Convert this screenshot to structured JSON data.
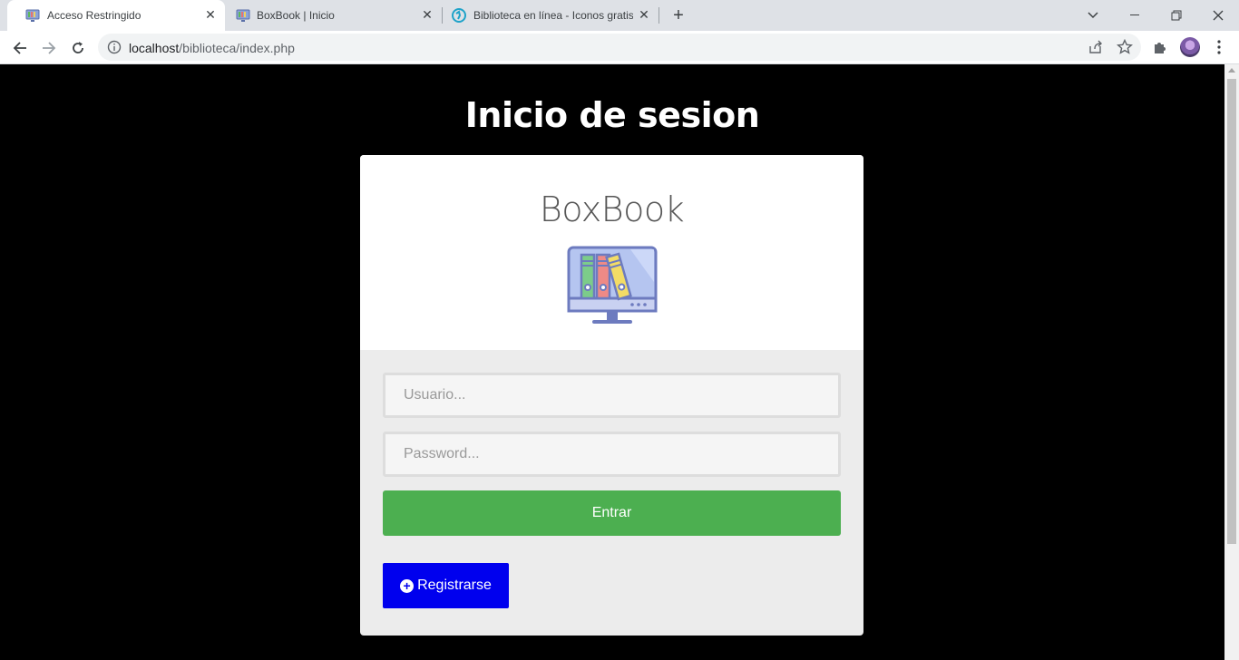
{
  "browser": {
    "tabs": [
      {
        "title": "Acceso Restringido",
        "active": true
      },
      {
        "title": "BoxBook | Inicio",
        "active": false
      },
      {
        "title": "Biblioteca en línea - Iconos gratis",
        "active": false
      }
    ],
    "address": {
      "host": "localhost",
      "path": "/biblioteca/index.php"
    }
  },
  "page": {
    "heading": "Inicio de sesion",
    "brand": "BoxBook",
    "username_placeholder": "Usuario...",
    "password_placeholder": "Password...",
    "enter_label": "Entrar",
    "register_label": "Registrarse"
  },
  "colors": {
    "enter_button": "#4caf50",
    "register_button": "#0000ee",
    "page_background": "#000000"
  }
}
